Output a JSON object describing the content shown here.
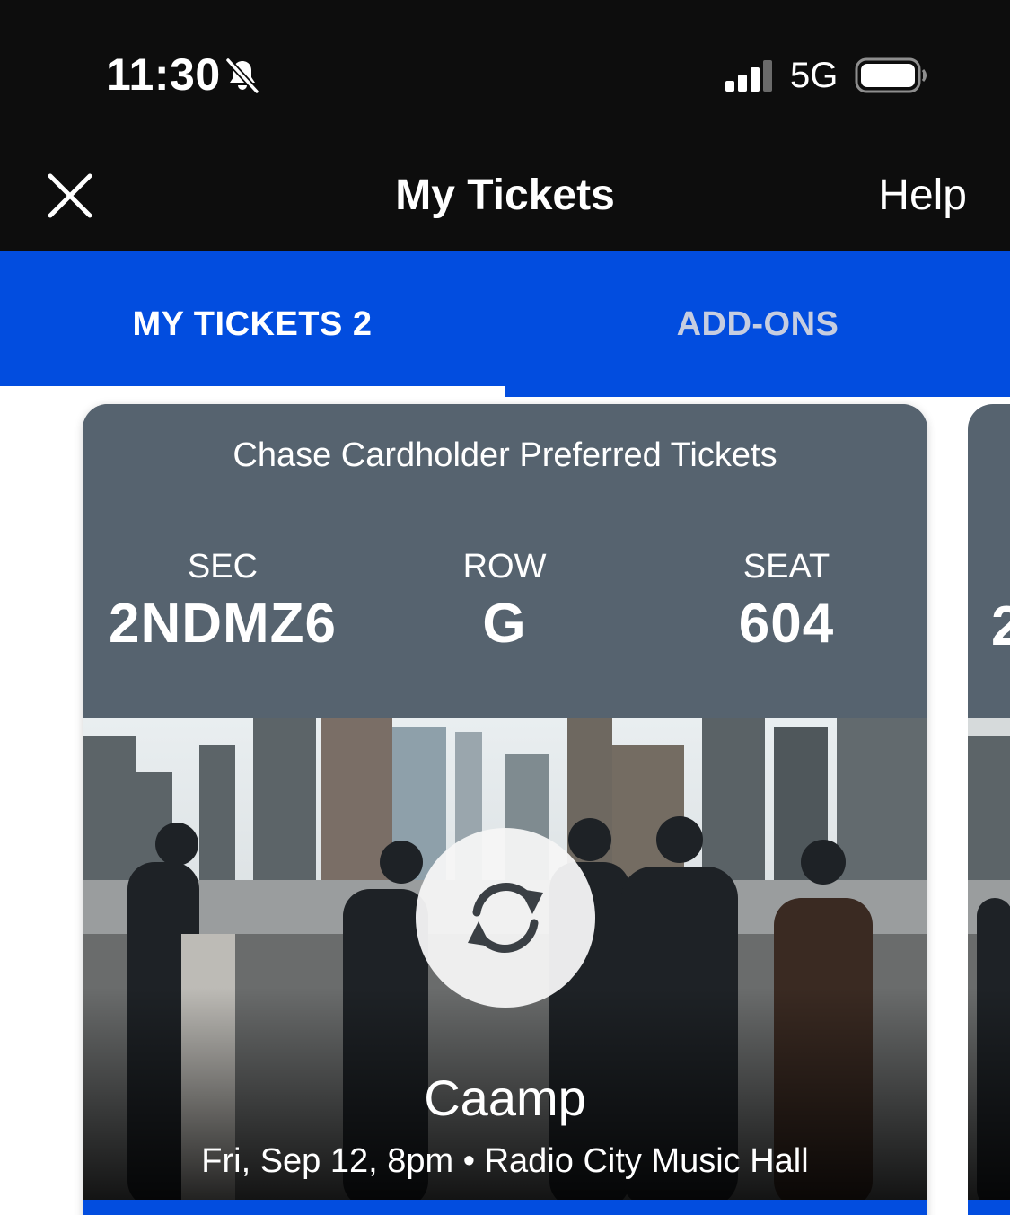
{
  "status_bar": {
    "time": "11:30",
    "network": "5G",
    "icons": [
      "bell-slash-icon",
      "signal-icon",
      "battery-icon"
    ]
  },
  "nav": {
    "title": "My Tickets",
    "help_label": "Help",
    "close_icon": "close-icon"
  },
  "tabs": [
    {
      "label": "MY TICKETS 2",
      "active": true
    },
    {
      "label": "ADD-ONS",
      "active": false
    }
  ],
  "ticket": {
    "category": "Chase Cardholder Preferred Tickets",
    "section_label": "SEC",
    "section": "2NDMZ6",
    "row_label": "ROW",
    "row": "G",
    "seat_label": "SEAT",
    "seat": "604",
    "rotate_icon": "rotate-icon",
    "event_name": "Caamp",
    "event_details": "Fri, Sep 12, 8pm • Radio City Music Hall"
  },
  "peek_ticket": {
    "section_partial": "2"
  },
  "colors": {
    "status_bg": "#0d0d0d",
    "brand_blue": "#024ddf",
    "card_header": "#56636f",
    "inactive_tab": "#c6cde0"
  }
}
